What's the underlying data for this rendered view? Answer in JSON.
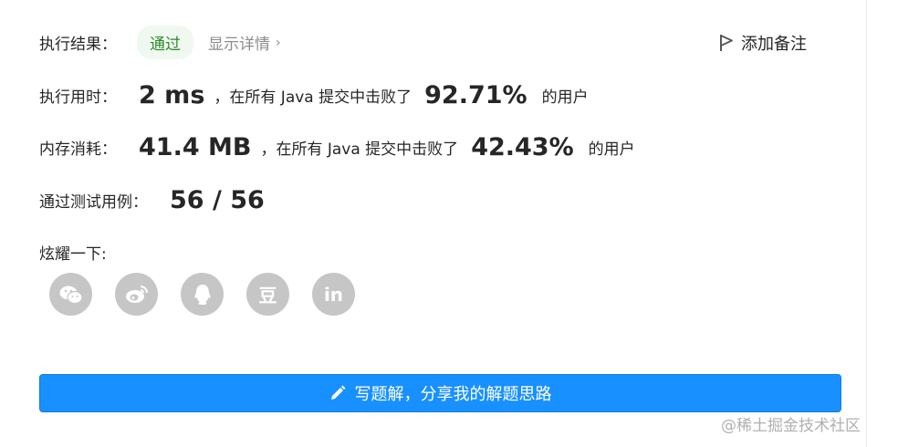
{
  "result": {
    "label": "执行结果：",
    "status": "通过",
    "details_link": "显示详情",
    "chevron": "›",
    "add_note": "添加备注"
  },
  "runtime": {
    "label": "执行用时：",
    "value": "2 ms",
    "middle_text": "，在所有 Java 提交中击败了",
    "percent": "92.71%",
    "suffix": "的用户"
  },
  "memory": {
    "label": "内存消耗：",
    "value": "41.4 MB",
    "middle_text": "，在所有 Java 提交中击败了",
    "percent": "42.43%",
    "suffix": "的用户"
  },
  "testcases": {
    "label": "通过测试用例：",
    "value": "56 / 56"
  },
  "share": {
    "label": "炫耀一下:",
    "icons": [
      "wechat-icon",
      "weibo-icon",
      "qq-icon",
      "douban-icon",
      "linkedin-icon"
    ],
    "douban_glyph": "豆",
    "linkedin_glyph": "in"
  },
  "write_button": {
    "label": "写题解，分享我的解题思路"
  },
  "watermark": "@稀土掘金技术社区",
  "colors": {
    "accent": "#1890ff",
    "status_bg": "#f0f9f0",
    "status_text": "#2d8a2d",
    "share_icon_bg": "#c6c6c6"
  }
}
